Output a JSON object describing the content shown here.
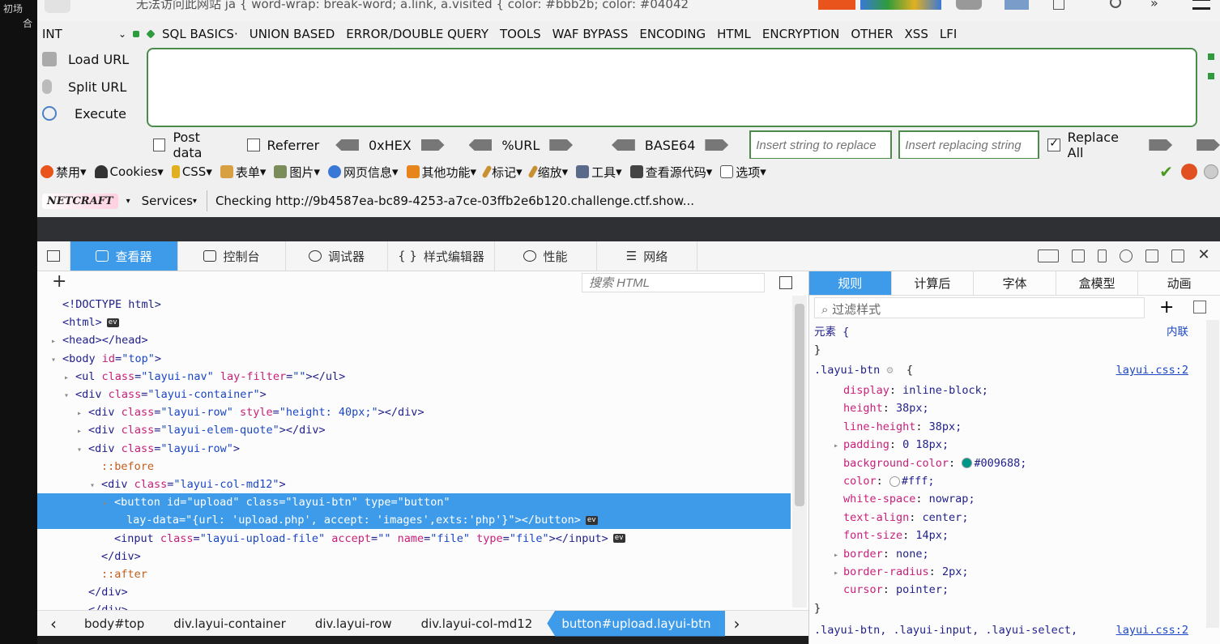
{
  "window": {
    "title_fragment": "无法访问此网站  ja { word-wrap: break-word; a.link, a.visited { color: #bbb2b; color: #04042"
  },
  "side_chars": [
    "初场",
    "合"
  ],
  "hackbar": {
    "type_select": "INT",
    "menus": [
      "SQL BASICS",
      "UNION BASED",
      "ERROR/DOUBLE QUERY",
      "TOOLS",
      "WAF BYPASS",
      "ENCODING",
      "HTML",
      "ENCRYPTION",
      "OTHER",
      "XSS",
      "LFI"
    ],
    "actions": [
      "Load URL",
      "Split URL",
      "Execute"
    ],
    "url_value": "",
    "post_data_label": "Post data",
    "referrer_label": "Referrer",
    "hex_label": "0xHEX",
    "url_label": "%URL",
    "base64_label": "BASE64",
    "replace_from_placeholder": "Insert string to replace",
    "replace_to_placeholder": "Insert replacing string",
    "replace_all_label": "Replace All",
    "replace_all_checked": true
  },
  "toolbar": {
    "items": [
      "禁用",
      "Cookies",
      "CSS",
      "表单",
      "图片",
      "网页信息",
      "其他功能",
      "标记",
      "缩放",
      "工具",
      "查看源代码",
      "选项"
    ],
    "netcraft_label": "NETCRAFT",
    "services_label": "Services",
    "checking_text": "Checking http://9b4587ea-bc89-4253-a7ce-03ffb2e6b120.challenge.ctf.show..."
  },
  "devtools": {
    "tabs": [
      "查看器",
      "控制台",
      "调试器",
      "样式编辑器",
      "性能",
      "网络"
    ],
    "active_tab": "查看器",
    "search_placeholder": "搜索 HTML",
    "html_lines": [
      {
        "indent": 0,
        "tw": "",
        "text": "<!DOCTYPE html>"
      },
      {
        "indent": 0,
        "tw": "",
        "text": "<html>",
        "ev": true
      },
      {
        "indent": 0,
        "tw": "▸",
        "text": "<head></head>"
      },
      {
        "indent": 0,
        "tw": "▾",
        "text": "<body id=\"top\">"
      },
      {
        "indent": 1,
        "tw": "▸",
        "text": "<ul class=\"layui-nav\" lay-filter=\"\"></ul>"
      },
      {
        "indent": 1,
        "tw": "▾",
        "text": "<div class=\"layui-container\">"
      },
      {
        "indent": 2,
        "tw": "▸",
        "text": "<div class=\"layui-row\" style=\"height: 40px;\"></div>"
      },
      {
        "indent": 2,
        "tw": "▸",
        "text": "<div class=\"layui-elem-quote\"></div>"
      },
      {
        "indent": 2,
        "tw": "▾",
        "text": "<div class=\"layui-row\">"
      },
      {
        "indent": 3,
        "tw": "",
        "text": "::before"
      },
      {
        "indent": 3,
        "tw": "▾",
        "text": "<div class=\"layui-col-md12\">"
      },
      {
        "indent": 4,
        "tw": "▸",
        "text": "<button id=\"upload\" class=\"layui-btn\" type=\"button\"",
        "selected": true
      },
      {
        "indent": 4,
        "tw": "",
        "text": "lay-data=\"{url: 'upload.php', accept: 'images',exts:'php'}\"></button>",
        "selected": true,
        "ev": true,
        "cont": true
      },
      {
        "indent": 4,
        "tw": "",
        "text": "<input class=\"layui-upload-file\" accept=\"\" name=\"file\" type=\"file\"></input>",
        "ev": true
      },
      {
        "indent": 3,
        "tw": "",
        "text": "</div>"
      },
      {
        "indent": 3,
        "tw": "",
        "text": "::after"
      },
      {
        "indent": 2,
        "tw": "",
        "text": "</div>"
      },
      {
        "indent": 2,
        "tw": "",
        "text": "</div>"
      }
    ],
    "breadcrumb": [
      "body#top",
      "div.layui-container",
      "div.layui-row",
      "div.layui-col-md12",
      "button#upload.layui-btn"
    ],
    "rules_tabs": [
      "规则",
      "计算后",
      "字体",
      "盒模型",
      "动画"
    ],
    "filter_placeholder": "过滤样式",
    "element_label": "元素 {",
    "inline_label": "内联",
    "rule_selector": ".layui-btn",
    "rule_source": "layui.css:2",
    "declarations": [
      {
        "prop": "display",
        "val": "inline-block;"
      },
      {
        "prop": "height",
        "val": "38px;"
      },
      {
        "prop": "line-height",
        "val": "38px;"
      },
      {
        "prop": "padding",
        "val": "0 18px;",
        "expand": true
      },
      {
        "prop": "background-color",
        "val": "#009688;",
        "swatch": "#009688"
      },
      {
        "prop": "color",
        "val": "#fff;",
        "swatch": "#ffffff"
      },
      {
        "prop": "white-space",
        "val": "nowrap;"
      },
      {
        "prop": "text-align",
        "val": "center;"
      },
      {
        "prop": "font-size",
        "val": "14px;"
      },
      {
        "prop": "border",
        "val": "none;",
        "expand": true
      },
      {
        "prop": "border-radius",
        "val": "2px;",
        "expand": true
      },
      {
        "prop": "cursor",
        "val": "pointer;"
      }
    ],
    "next_rule": ".layui-btn, .layui-input, .layui-select,"
  }
}
